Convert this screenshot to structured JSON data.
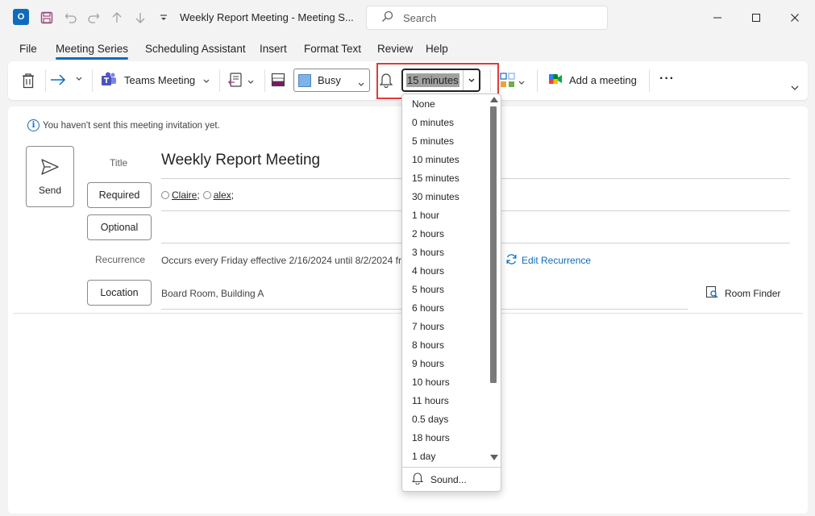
{
  "window": {
    "title": "Weekly Report Meeting  -  Meeting S...",
    "search_placeholder": "Search",
    "app_icon": "outlook-icon",
    "controls": [
      "minimize",
      "maximize",
      "close"
    ]
  },
  "quick_access": [
    "save-icon",
    "undo-icon",
    "redo-icon",
    "arrow-up-icon",
    "arrow-down-icon",
    "customize-icon"
  ],
  "menu": {
    "items": [
      "File",
      "Meeting Series",
      "Scheduling Assistant",
      "Insert",
      "Format Text",
      "Review",
      "Help"
    ],
    "active": "Meeting Series"
  },
  "ribbon": {
    "teams_label": "Teams Meeting",
    "show_as_value": "Busy",
    "reminder_value": "15 minutes",
    "add_meeting_label": "Add a meeting",
    "more_label": "···",
    "colors": {
      "busy": "#7fb2e5",
      "accent": "#0f6cbd",
      "highlight": "#e23a3a"
    }
  },
  "form": {
    "info_text": "You haven't sent this meeting invitation yet.",
    "send_label": "Send",
    "title_label": "Title",
    "title_value": "Weekly Report Meeting",
    "required_label": "Required",
    "attendees": [
      "Claire",
      "alex"
    ],
    "optional_label": "Optional",
    "recurrence_label": "Recurrence",
    "recurrence_text": "Occurs every Friday effective 2/16/2024 until 8/2/2024 fro",
    "edit_recurrence_label": "Edit Recurrence",
    "location_label": "Location",
    "location_value": "Board Room, Building A",
    "room_finder_label": "Room Finder"
  },
  "reminder_dropdown": {
    "options": [
      "None",
      "0 minutes",
      "5 minutes",
      "10 minutes",
      "15 minutes",
      "30 minutes",
      "1 hour",
      "2 hours",
      "3 hours",
      "4 hours",
      "5 hours",
      "6 hours",
      "7 hours",
      "8 hours",
      "9 hours",
      "10 hours",
      "11 hours",
      "0.5 days",
      "18 hours",
      "1 day"
    ],
    "sound_label": "Sound..."
  }
}
